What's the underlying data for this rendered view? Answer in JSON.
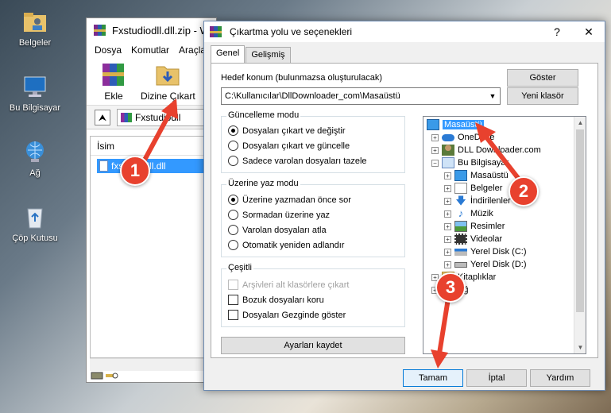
{
  "desktop": {
    "icons": [
      {
        "label": "Belgeler"
      },
      {
        "label": "Bu Bilgisayar"
      },
      {
        "label": "Ağ"
      },
      {
        "label": "Çöp Kutusu"
      }
    ]
  },
  "winrar": {
    "title": "Fxstudiodll.dll.zip - W",
    "menu": [
      "Dosya",
      "Komutlar",
      "Araçlar"
    ],
    "tools": {
      "add": "Ekle",
      "extract": "Dizine Çıkart"
    },
    "path": "Fxstudiodll",
    "list": {
      "header": "İsim",
      "file": "fxstudiodll.dll"
    }
  },
  "dialog": {
    "title": "Çıkartma yolu ve seçenekleri",
    "close": "✕",
    "help": "?",
    "tabs": [
      "Genel",
      "Gelişmiş"
    ],
    "dest_label": "Hedef konum (bulunmazsa oluşturulacak)",
    "dest_value": "C:\\Kullanıcılar\\DllDownloader_com\\Masaüstü",
    "show_button": "Göster",
    "new_folder_button": "Yeni klasör",
    "update_group": {
      "title": "Güncelleme modu",
      "options": [
        "Dosyaları çıkart ve değiştir",
        "Dosyaları çıkart ve güncelle",
        "Sadece varolan dosyaları tazele"
      ]
    },
    "overwrite_group": {
      "title": "Üzerine yaz modu",
      "options": [
        "Üzerine yazmadan önce sor",
        "Sormadan üzerine yaz",
        "Varolan dosyaları atla",
        "Otomatik yeniden adlandır"
      ]
    },
    "misc_group": {
      "title": "Çeşitli",
      "options": [
        "Arşivleri alt klasörlere çıkart",
        "Bozuk dosyaları koru",
        "Dosyaları Gezginde göster"
      ]
    },
    "save_settings": "Ayarları kaydet",
    "tree": [
      "Masaüstü",
      "OneDrive",
      "DLL Downloader.com",
      "Bu Bilgisayar",
      "Masaüstü",
      "Belgeler",
      "İndirilenler",
      "Müzik",
      "Resimler",
      "Videolar",
      "Yerel Disk (C:)",
      "Yerel Disk (D:)",
      "Kitaplıklar",
      "Ağ"
    ],
    "ok": "Tamam",
    "cancel": "İptal",
    "help_button": "Yardım"
  },
  "annotations": [
    "1",
    "2",
    "3"
  ],
  "colors": {
    "annotation": "#e8412e",
    "selection": "#3399ff",
    "accent": "#0078d7"
  }
}
